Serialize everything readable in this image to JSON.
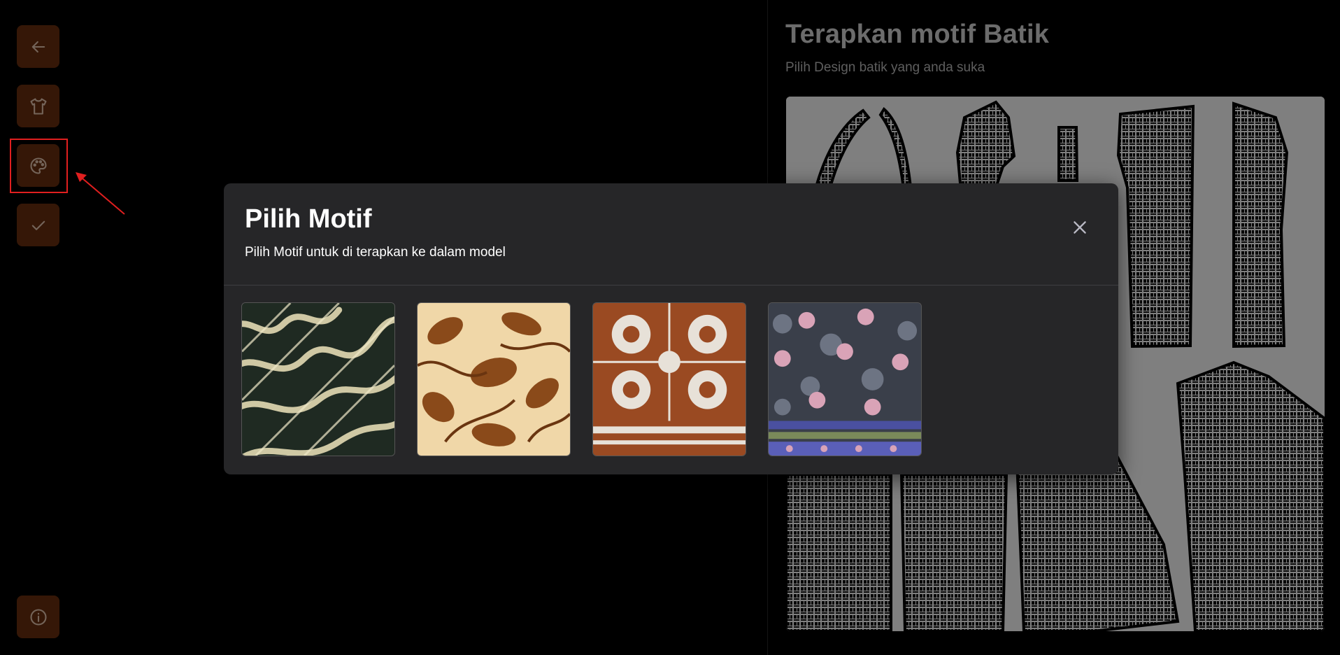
{
  "sidebar": {
    "buttons": [
      {
        "icon": "arrow-left-icon"
      },
      {
        "icon": "shirt-icon"
      },
      {
        "icon": "palette-icon"
      },
      {
        "icon": "check-icon"
      },
      {
        "icon": "info-icon"
      }
    ]
  },
  "right_panel": {
    "title": "Terapkan motif Batik",
    "subtitle": "Pilih Design batik yang anda suka"
  },
  "modal": {
    "title": "Pilih Motif",
    "subtitle": "Pilih Motif untuk di terapkan ke dalam model",
    "motifs": [
      {
        "name": "parang",
        "colors": [
          "#1f2a22",
          "#cfc8a4"
        ]
      },
      {
        "name": "floral-sogan",
        "colors": [
          "#8a4a1a",
          "#f0d7a8"
        ]
      },
      {
        "name": "ceplok",
        "colors": [
          "#9a4a22",
          "#e7e1d8"
        ]
      },
      {
        "name": "pink-floral",
        "colors": [
          "#3a3f4a",
          "#d9a3b7"
        ]
      }
    ]
  },
  "colors": {
    "button_bg": "#6b2f0f",
    "button_icon": "#e9c9b2",
    "modal_bg": "#262628",
    "annotation": "#e01f1f"
  }
}
